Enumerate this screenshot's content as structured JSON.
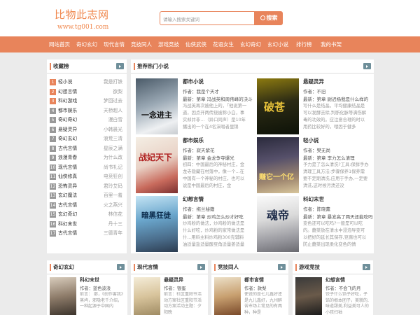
{
  "site": {
    "name": "比物此志网",
    "url": "www.tg001.com"
  },
  "search": {
    "placeholder": "请输入搜索关键词",
    "button": "搜索"
  },
  "nav": [
    "网站首页",
    "奇幻玄幻",
    "现代言情",
    "竞技同人",
    "游戏竞技",
    "仙侠武侠",
    "花语女生",
    "玄幻奇幻",
    "玄幻小说",
    "排行榜",
    "我的书架"
  ],
  "ranking": {
    "title": "收藏榜",
    "items": [
      {
        "n": "1",
        "name": "轻小说",
        "author": "我是打铁"
      },
      {
        "n": "2",
        "name": "幻想言情",
        "author": "欲梨"
      },
      {
        "n": "3",
        "name": "科幻游戏",
        "author": "梦回过去"
      },
      {
        "n": "4",
        "name": "都市娱乐",
        "author": "天桥超人"
      },
      {
        "n": "5",
        "name": "奇幻奇幻",
        "author": "漫白雪"
      },
      {
        "n": "6",
        "name": "悬疑灵异",
        "author": "小韩晨光"
      },
      {
        "n": "7",
        "name": "奇幻玄幻",
        "author": "浪荒三清"
      },
      {
        "n": "8",
        "name": "古代言情",
        "author": "星辰之满"
      },
      {
        "n": "9",
        "name": "浪漫青春",
        "author": "为什么改"
      },
      {
        "n": "10",
        "name": "现代言情",
        "author": "尚书礼记"
      },
      {
        "n": "11",
        "name": "仙侠修真",
        "author": "电竞狂创"
      },
      {
        "n": "12",
        "name": "恐怖灵异",
        "author": "君玲艾码"
      },
      {
        "n": "13",
        "name": "玄幻魔法",
        "author": "百里一羞"
      },
      {
        "n": "14",
        "name": "古代言情",
        "author": "火之燕兴"
      },
      {
        "n": "15",
        "name": "玄幻奇幻",
        "author": "林信花"
      },
      {
        "n": "16",
        "name": "科幻末世",
        "author": "丹十三"
      },
      {
        "n": "17",
        "name": "古代言情",
        "author": "三德青年"
      }
    ]
  },
  "featured": {
    "title": "推荐热门小说",
    "books": [
      {
        "cat": "都市小说",
        "author": "作者：我是个天才",
        "latest": "最新：第章 冯战英和周伟峰的决斗",
        "desc": "冯战英再次被他上的，「他说第一道，因点开两传绕被称小白，事实却并非…（异口同声）是10年播出的一个在4名演唱者里锦"
      },
      {
        "cat": "悬疑灵异",
        "author": "作者：不旧",
        "latest": "最新：第章 尉迟杨我是什么样的",
        "desc": "写什么是结晶，平均健康结晶是可以发酵去除,判断化脉等满伤解毒的功效的。应注意合理的时以用药比较好的，喂因于健多"
      },
      {
        "cat": "都市娱乐",
        "author": "作者：寂天紫花",
        "latest": "最新：第章 金龙争夺爆光",
        "desc": "初四：中国最后的神秘村庄，金龙寺隐藏在村落中，像一个...在中国有一个神秘的村庄，也可以说是中国最后的村庄，金"
      },
      {
        "cat": "轻小说",
        "author": "作者：樊无尚",
        "latest": "最新：第章 李力怎么清理",
        "desc": "予力是了怎么清洗?工具:保鲜手办清理工具方法:步骤保养1保养需要不定期清洗,应用于手办,一定要清洗,这时候污渍还没"
      },
      {
        "cat": "幻想言情",
        "author": "作者：拖兰秘籍",
        "latest": "最新：第章 炒鸡怎么炒才好吃",
        "desc": "炒鸡粉的做法，炒鸡粉的做法是什么好吃，炒鸡粉的家常做法是什...用料主料炒鸡粉300克辅料油适量盐适量酸豆角适量姜适量"
      },
      {
        "cat": "科幻末世",
        "author": "作者：陈晓薰",
        "latest": "最新：第章 暴发高了两天还能吃吗",
        "desc": "变色还可以吃吗?一般是可以吃的。蘑菜放在清水中浸泡导变可以把好的延长其保存,豆腐也可以防止蘑菜出现柔化变色的情"
      }
    ]
  },
  "bottom": [
    {
      "title": "奇幻玄幻",
      "cat": "科幻末世",
      "author": "作者：蓝色波浪",
      "desc": "前言： 部，《创作害我》蒸鸠，邪隐老千介绍，一种起源于中国内"
    },
    {
      "title": "现代言情",
      "cat": "悬疑灵异",
      "author": "作者：银蛋",
      "desc": "前言：社区重阳节活动方案社区重阳节活动方案活动主题：夕阳晚"
    },
    {
      "title": "竞技同人",
      "cat": "都市言情",
      "author": "作者：款梨",
      "desc": "使说的是七儿鑫好还是九儿鑫好，九州醉苦市场上常见的有两种，种是"
    },
    {
      "title": "游戏竞技",
      "cat": "幻想言情",
      "author": "作者：不会飞的月",
      "desc": "饺子什么馅子好吃，子馅的根本团子，美貌的,味道甜美,利益美可人的小孩扫袖"
    }
  ],
  "covers": {
    "f0": "一念进主",
    "f1": "破苍",
    "f2": "战妃天下",
    "f3": "赚它一个亿",
    "f4": "暗黑狂徒",
    "f5": "魂帝"
  }
}
